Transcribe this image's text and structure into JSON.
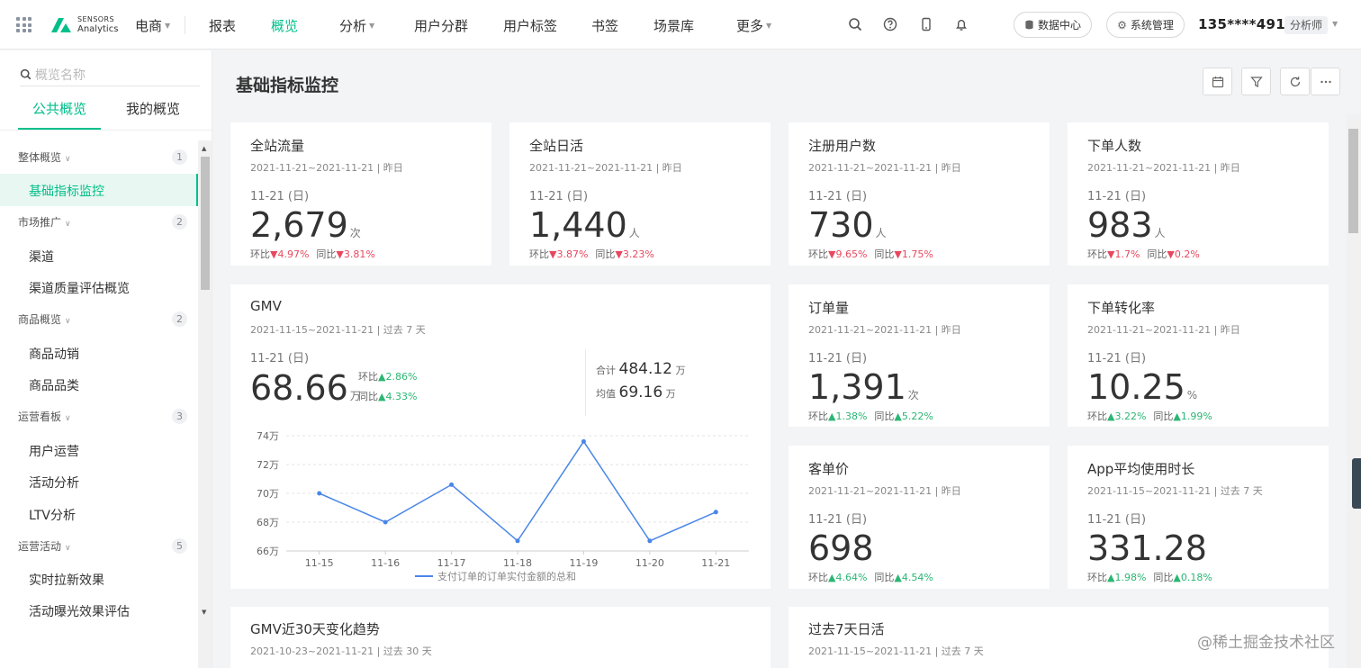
{
  "header": {
    "brand_line1": "SENSORS",
    "brand_line2": "Analytics",
    "project": "电商",
    "nav": [
      {
        "label": "报表"
      },
      {
        "label": "概览"
      },
      {
        "label": "分析"
      },
      {
        "label": "用户分群"
      },
      {
        "label": "用户标签"
      },
      {
        "label": "书签"
      },
      {
        "label": "场景库"
      },
      {
        "label": "更多"
      }
    ],
    "data_center": "数据中心",
    "sys_mgmt": "系统管理",
    "user": "135****4915",
    "role": "分析师"
  },
  "sidebar": {
    "search_placeholder": "概览名称",
    "tab_public": "公共概览",
    "tab_mine": "我的概览",
    "groups": [
      {
        "label": "整体概览",
        "count": "1",
        "items": [
          "基础指标监控"
        ]
      },
      {
        "label": "市场推广",
        "count": "2",
        "items": [
          "渠道",
          "渠道质量评估概览"
        ]
      },
      {
        "label": "商品概览",
        "count": "2",
        "items": [
          "商品动销",
          "商品品类"
        ]
      },
      {
        "label": "运营看板",
        "count": "3",
        "items": [
          "用户运营",
          "活动分析",
          "LTV分析"
        ]
      },
      {
        "label": "运营活动",
        "count": "5",
        "items": [
          "实时拉新效果",
          "活动曝光效果评估"
        ]
      }
    ]
  },
  "page": {
    "title": "基础指标监控"
  },
  "cards": [
    {
      "title": "全站流量",
      "range": "2021-11-21~2021-11-21 | 昨日",
      "day": "11-21 (日)",
      "value": "2,679",
      "unit": "次",
      "mom_label": "环比",
      "mom": "4.97%",
      "yoy_label": "同比",
      "yoy": "3.81%"
    },
    {
      "title": "全站日活",
      "range": "2021-11-21~2021-11-21 | 昨日",
      "day": "11-21 (日)",
      "value": "1,440",
      "unit": "人",
      "mom_label": "环比",
      "mom": "3.87%",
      "yoy_label": "同比",
      "yoy": "3.23%"
    },
    {
      "title": "注册用户数",
      "range": "2021-11-21~2021-11-21 | 昨日",
      "day": "11-21 (日)",
      "value": "730",
      "unit": "人",
      "mom_label": "环比",
      "mom": "9.65%",
      "yoy_label": "同比",
      "yoy": "1.75%"
    },
    {
      "title": "下单人数",
      "range": "2021-11-21~2021-11-21 | 昨日",
      "day": "11-21 (日)",
      "value": "983",
      "unit": "人",
      "mom_label": "环比",
      "mom": "1.7%",
      "yoy_label": "同比",
      "yoy": "0.2%"
    },
    {
      "title": "订单量",
      "range": "2021-11-21~2021-11-21 | 昨日",
      "day": "11-21 (日)",
      "value": "1,391",
      "unit": "次",
      "mom_label": "环比",
      "mom": "1.38%",
      "yoy_label": "同比",
      "yoy": "5.22%"
    },
    {
      "title": "下单转化率",
      "range": "2021-11-21~2021-11-21 | 昨日",
      "day": "11-21 (日)",
      "value": "10.25",
      "unit": "%",
      "mom_label": "环比",
      "mom": "3.22%",
      "yoy_label": "同比",
      "yoy": "1.99%"
    },
    {
      "title": "客单价",
      "range": "2021-11-21~2021-11-21 | 昨日",
      "day": "11-21 (日)",
      "value": "698",
      "unit": "",
      "mom_label": "环比",
      "mom": "4.64%",
      "yoy_label": "同比",
      "yoy": "4.54%"
    },
    {
      "title": "App平均使用时长",
      "range": "2021-11-15~2021-11-21 | 过去 7 天",
      "day": "11-21 (日)",
      "value": "331.28",
      "unit": "",
      "mom_label": "环比",
      "mom": "1.98%",
      "yoy_label": "同比",
      "yoy": "0.18%"
    }
  ],
  "gmv": {
    "title": "GMV",
    "range": "2021-11-15~2021-11-21 | 过去 7 天",
    "day": "11-21 (日)",
    "value": "68.66",
    "unit": "万",
    "mom_label": "环比",
    "mom": "2.86%",
    "yoy_label": "同比",
    "yoy": "4.33%",
    "total_label": "合计",
    "total": "484.12",
    "total_unit": "万",
    "avg_label": "均值",
    "avg": "69.16",
    "avg_unit": "万"
  },
  "bottom": {
    "gmv30_title": "GMV近30天变化趋势",
    "gmv30_range": "2021-10-23~2021-11-21 | 过去 30 天",
    "dau7_title": "过去7天日活",
    "dau7_range": "2021-11-15~2021-11-21 | 过去 7 天"
  },
  "watermark": "@稀土掘金技术社区",
  "colors": {
    "accent": "#00bf8a",
    "down": "#e8485e",
    "up": "#2bb673",
    "line": "#4a86e8"
  },
  "chart_data": {
    "type": "line",
    "categories": [
      "11-15",
      "11-16",
      "11-17",
      "11-18",
      "11-19",
      "11-20",
      "11-21"
    ],
    "series": [
      {
        "name": "支付订单的订单实付金额的总和",
        "values": [
          70.0,
          68.0,
          70.6,
          66.7,
          73.6,
          66.7,
          68.7
        ]
      }
    ],
    "ylim": [
      66,
      74
    ],
    "yticks": [
      66,
      68,
      70,
      72,
      74
    ],
    "ytick_labels": [
      "66万",
      "68万",
      "70万",
      "72万",
      "74万"
    ],
    "grid": true,
    "legend": "bottom"
  }
}
